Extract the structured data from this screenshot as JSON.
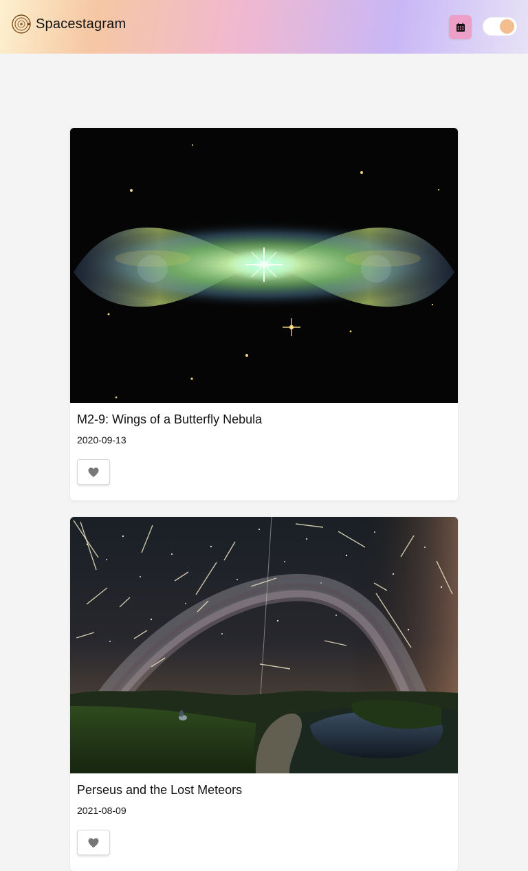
{
  "app": {
    "title": "Spacestagram"
  },
  "header": {
    "logo_icon": "spacestagram-logo-icon",
    "calendar_icon": "calendar-icon",
    "theme_toggle_state": "on",
    "colors": {
      "calendar_button": "#ee9fc8",
      "toggle_knob": "#f3be8f"
    }
  },
  "posts": [
    {
      "title": "M2-9: Wings of a Butterfly Nebula",
      "date": "2020-09-13",
      "like_icon": "heart-icon"
    },
    {
      "title": "Perseus and the Lost Meteors",
      "date": "2021-08-09",
      "like_icon": "heart-icon"
    }
  ]
}
